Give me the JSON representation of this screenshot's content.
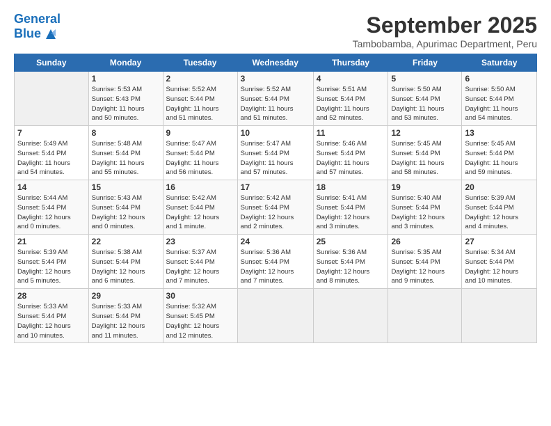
{
  "header": {
    "logo_line1": "General",
    "logo_line2": "Blue",
    "month": "September 2025",
    "location": "Tambobamba, Apurimac Department, Peru"
  },
  "days_of_week": [
    "Sunday",
    "Monday",
    "Tuesday",
    "Wednesday",
    "Thursday",
    "Friday",
    "Saturday"
  ],
  "weeks": [
    [
      {
        "day": "",
        "info": ""
      },
      {
        "day": "1",
        "info": "Sunrise: 5:53 AM\nSunset: 5:43 PM\nDaylight: 11 hours\nand 50 minutes."
      },
      {
        "day": "2",
        "info": "Sunrise: 5:52 AM\nSunset: 5:44 PM\nDaylight: 11 hours\nand 51 minutes."
      },
      {
        "day": "3",
        "info": "Sunrise: 5:52 AM\nSunset: 5:44 PM\nDaylight: 11 hours\nand 51 minutes."
      },
      {
        "day": "4",
        "info": "Sunrise: 5:51 AM\nSunset: 5:44 PM\nDaylight: 11 hours\nand 52 minutes."
      },
      {
        "day": "5",
        "info": "Sunrise: 5:50 AM\nSunset: 5:44 PM\nDaylight: 11 hours\nand 53 minutes."
      },
      {
        "day": "6",
        "info": "Sunrise: 5:50 AM\nSunset: 5:44 PM\nDaylight: 11 hours\nand 54 minutes."
      }
    ],
    [
      {
        "day": "7",
        "info": "Sunrise: 5:49 AM\nSunset: 5:44 PM\nDaylight: 11 hours\nand 54 minutes."
      },
      {
        "day": "8",
        "info": "Sunrise: 5:48 AM\nSunset: 5:44 PM\nDaylight: 11 hours\nand 55 minutes."
      },
      {
        "day": "9",
        "info": "Sunrise: 5:47 AM\nSunset: 5:44 PM\nDaylight: 11 hours\nand 56 minutes."
      },
      {
        "day": "10",
        "info": "Sunrise: 5:47 AM\nSunset: 5:44 PM\nDaylight: 11 hours\nand 57 minutes."
      },
      {
        "day": "11",
        "info": "Sunrise: 5:46 AM\nSunset: 5:44 PM\nDaylight: 11 hours\nand 57 minutes."
      },
      {
        "day": "12",
        "info": "Sunrise: 5:45 AM\nSunset: 5:44 PM\nDaylight: 11 hours\nand 58 minutes."
      },
      {
        "day": "13",
        "info": "Sunrise: 5:45 AM\nSunset: 5:44 PM\nDaylight: 11 hours\nand 59 minutes."
      }
    ],
    [
      {
        "day": "14",
        "info": "Sunrise: 5:44 AM\nSunset: 5:44 PM\nDaylight: 12 hours\nand 0 minutes."
      },
      {
        "day": "15",
        "info": "Sunrise: 5:43 AM\nSunset: 5:44 PM\nDaylight: 12 hours\nand 0 minutes."
      },
      {
        "day": "16",
        "info": "Sunrise: 5:42 AM\nSunset: 5:44 PM\nDaylight: 12 hours\nand 1 minute."
      },
      {
        "day": "17",
        "info": "Sunrise: 5:42 AM\nSunset: 5:44 PM\nDaylight: 12 hours\nand 2 minutes."
      },
      {
        "day": "18",
        "info": "Sunrise: 5:41 AM\nSunset: 5:44 PM\nDaylight: 12 hours\nand 3 minutes."
      },
      {
        "day": "19",
        "info": "Sunrise: 5:40 AM\nSunset: 5:44 PM\nDaylight: 12 hours\nand 3 minutes."
      },
      {
        "day": "20",
        "info": "Sunrise: 5:39 AM\nSunset: 5:44 PM\nDaylight: 12 hours\nand 4 minutes."
      }
    ],
    [
      {
        "day": "21",
        "info": "Sunrise: 5:39 AM\nSunset: 5:44 PM\nDaylight: 12 hours\nand 5 minutes."
      },
      {
        "day": "22",
        "info": "Sunrise: 5:38 AM\nSunset: 5:44 PM\nDaylight: 12 hours\nand 6 minutes."
      },
      {
        "day": "23",
        "info": "Sunrise: 5:37 AM\nSunset: 5:44 PM\nDaylight: 12 hours\nand 7 minutes."
      },
      {
        "day": "24",
        "info": "Sunrise: 5:36 AM\nSunset: 5:44 PM\nDaylight: 12 hours\nand 7 minutes."
      },
      {
        "day": "25",
        "info": "Sunrise: 5:36 AM\nSunset: 5:44 PM\nDaylight: 12 hours\nand 8 minutes."
      },
      {
        "day": "26",
        "info": "Sunrise: 5:35 AM\nSunset: 5:44 PM\nDaylight: 12 hours\nand 9 minutes."
      },
      {
        "day": "27",
        "info": "Sunrise: 5:34 AM\nSunset: 5:44 PM\nDaylight: 12 hours\nand 10 minutes."
      }
    ],
    [
      {
        "day": "28",
        "info": "Sunrise: 5:33 AM\nSunset: 5:44 PM\nDaylight: 12 hours\nand 10 minutes."
      },
      {
        "day": "29",
        "info": "Sunrise: 5:33 AM\nSunset: 5:44 PM\nDaylight: 12 hours\nand 11 minutes."
      },
      {
        "day": "30",
        "info": "Sunrise: 5:32 AM\nSunset: 5:45 PM\nDaylight: 12 hours\nand 12 minutes."
      },
      {
        "day": "",
        "info": ""
      },
      {
        "day": "",
        "info": ""
      },
      {
        "day": "",
        "info": ""
      },
      {
        "day": "",
        "info": ""
      }
    ]
  ]
}
